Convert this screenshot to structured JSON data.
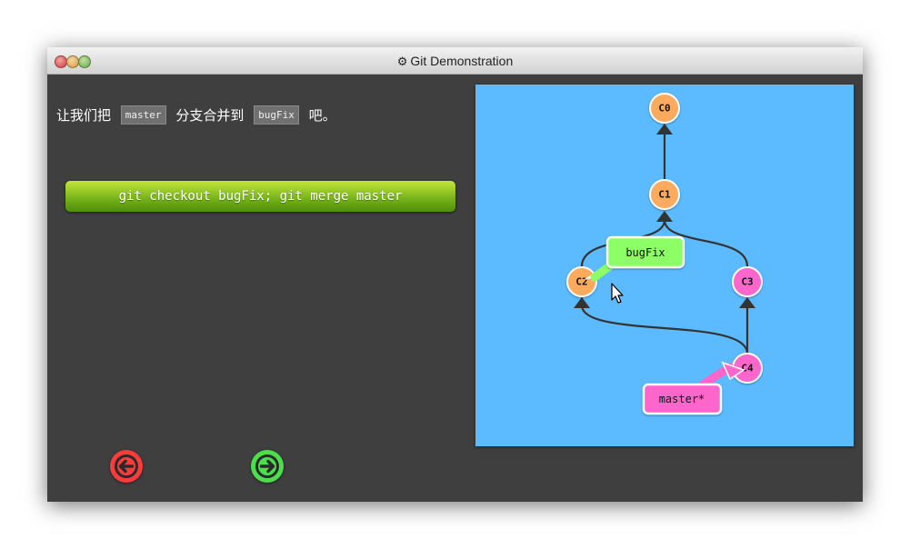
{
  "window": {
    "title": "Git Demonstration",
    "title_icon": "gear-icon"
  },
  "instruction": {
    "prefix": "让我们把",
    "source_branch": "master",
    "middle": "分支合并到",
    "target_branch": "bugFix",
    "suffix": "吧。"
  },
  "command": {
    "text": "git checkout bugFix; git merge master"
  },
  "navigation": {
    "prev_icon": "arrow-left-icon",
    "next_icon": "arrow-right-icon",
    "prev_color": "#ff3b3b",
    "next_color": "#4cdf4c"
  },
  "graph": {
    "background": "#5cbaff",
    "commits": [
      {
        "id": "C0",
        "color": "#ffaa5c"
      },
      {
        "id": "C1",
        "color": "#ffaa5c"
      },
      {
        "id": "C2",
        "color": "#ffaa5c"
      },
      {
        "id": "C3",
        "color": "#ff66cc"
      },
      {
        "id": "C4",
        "color": "#ff66cc"
      }
    ],
    "branches": [
      {
        "name": "bugFix",
        "target": "C2",
        "color": "#8cff66"
      },
      {
        "name": "master*",
        "target": "C4",
        "color": "#ff66cc"
      }
    ]
  }
}
